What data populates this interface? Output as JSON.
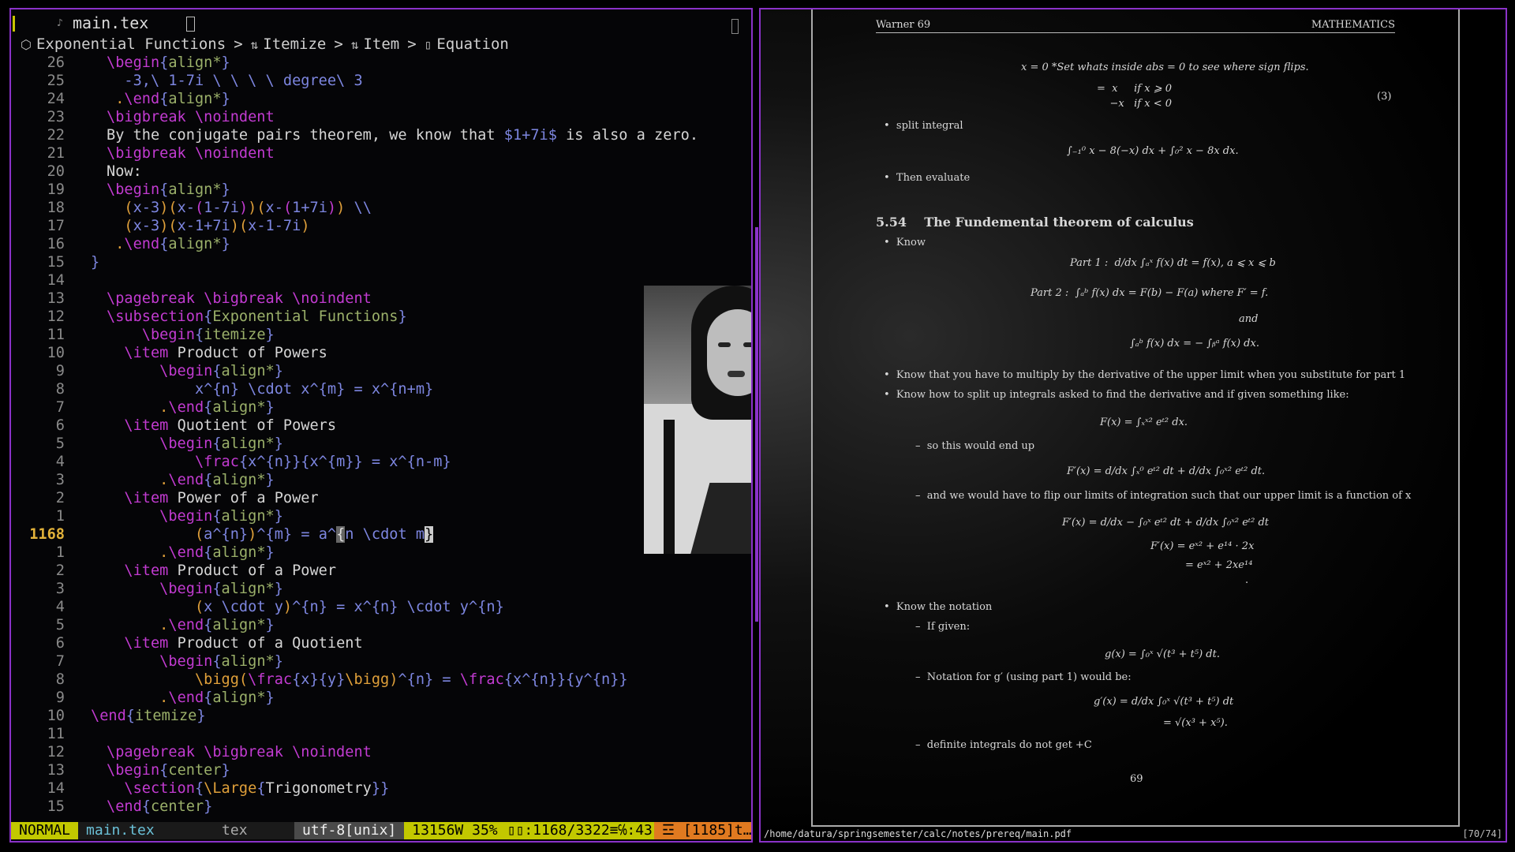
{
  "editor": {
    "tab": {
      "icon": "tex-file-icon",
      "name": "main.tex"
    },
    "winbar": {
      "crumb1": "Exponential Functions",
      "crumb2": "Itemize",
      "crumb3": "Item",
      "crumb4": "Equation"
    },
    "lines": [
      {
        "n": "26",
        "h": "<span class='k'>\\begin</span><span class='b'>{</span><span class='g'>align*</span><span class='b'>}</span>"
      },
      {
        "n": "25",
        "h": "  <span class='c'>-3,\\ 1-7i \\ \\ \\ \\ degree\\ 3</span>"
      },
      {
        "n": "24",
        "h": " <span class='o'>.</span><span class='k'>\\end</span><span class='b'>{</span><span class='g'>align*</span><span class='b'>}</span>"
      },
      {
        "n": "23",
        "h": "<span class='k'>\\bigbreak \\noindent</span>"
      },
      {
        "n": "22",
        "h": "<span class='w'>By the conjugate pairs theorem, we know that </span><span class='c'>$1+7i$</span><span class='w'> is also a zero.</span>"
      },
      {
        "n": "21",
        "h": "<span class='k'>\\bigbreak \\noindent</span>"
      },
      {
        "n": "20",
        "h": "<span class='w'>Now:</span>"
      },
      {
        "n": "19",
        "h": "<span class='k'>\\begin</span><span class='b'>{</span><span class='g'>align*</span><span class='b'>}</span>"
      },
      {
        "n": "18",
        "h": "  <span class='o'>(</span><span class='c'>x-3</span><span class='o'>)(</span><span class='c'>x-</span><span class='k'>(</span><span class='c'>1-7i</span><span class='k'>)</span><span class='o'>)(</span><span class='c'>x-</span><span class='k'>(</span><span class='c'>1+7i</span><span class='k'>)</span><span class='o'>)</span><span class='c'> \\\\</span>"
      },
      {
        "n": "17",
        "h": "  <span class='o'>(</span><span class='c'>x-3</span><span class='o'>)(</span><span class='c'>x-1+7i</span><span class='o'>)(</span><span class='c'>x-1-7i</span><span class='o'>)</span>"
      },
      {
        "n": "16",
        "h": " <span class='o'>.</span><span class='k'>\\end</span><span class='b'>{</span><span class='g'>align*</span><span class='b'>}</span>"
      },
      {
        "n": "15",
        "h": "<span class='b'>}</span>",
        "x": -20
      },
      {
        "n": "14",
        "h": ""
      },
      {
        "n": "13",
        "h": "<span class='k'>\\pagebreak \\bigbreak \\noindent</span>"
      },
      {
        "n": "12",
        "h": "<span class='k'>\\subsection</span><span class='b'>{</span><span class='g'>Exponential Functions</span><span class='b'>}</span>"
      },
      {
        "n": "11",
        "h": "    <span class='k'>\\begin</span><span class='b'>{</span><span class='g'>itemize</span><span class='b'>}</span>"
      },
      {
        "n": "10",
        "h": "  <span class='k'>\\item</span><span class='w'> Product of Powers</span>"
      },
      {
        "n": "9",
        "h": "      <span class='k'>\\begin</span><span class='b'>{</span><span class='g'>align*</span><span class='b'>}</span>"
      },
      {
        "n": "8",
        "h": "          <span class='c'>x^{n} \\cdot x^{m} = x^{n+m}</span>"
      },
      {
        "n": "7",
        "h": "      <span class='o'>.</span><span class='k'>\\end</span><span class='b'>{</span><span class='g'>align*</span><span class='b'>}</span>"
      },
      {
        "n": "6",
        "h": "  <span class='k'>\\item</span><span class='w'> Quotient of Powers</span>"
      },
      {
        "n": "5",
        "h": "      <span class='k'>\\begin</span><span class='b'>{</span><span class='g'>align*</span><span class='b'>}</span>"
      },
      {
        "n": "4",
        "h": "          <span class='k'>\\frac</span><span class='c'>{x^{n}}{x^{m}} = x^{n-m}</span>"
      },
      {
        "n": "3",
        "h": "      <span class='o'>.</span><span class='k'>\\end</span><span class='b'>{</span><span class='g'>align*</span><span class='b'>}</span>"
      },
      {
        "n": "2",
        "h": "  <span class='k'>\\item</span><span class='w'> Power of a Power</span>"
      },
      {
        "n": "1",
        "h": "      <span class='k'>\\begin</span><span class='b'>{</span><span class='g'>align*</span><span class='b'>}</span>"
      },
      {
        "n": "1168",
        "cur": true,
        "h": "          <span class='o'>(</span><span class='c'>a^{n}</span><span class='o'>)</span><span class='c'>^{m} = a^</span><span class='hl'>{</span><span class='c'>n \\cdot m</span><span class='cursor'>}</span>"
      },
      {
        "n": "1",
        "h": "      <span class='o'>.</span><span class='k'>\\end</span><span class='b'>{</span><span class='g'>align*</span><span class='b'>}</span>"
      },
      {
        "n": "2",
        "h": "  <span class='k'>\\item</span><span class='w'> Product of a Power</span>"
      },
      {
        "n": "3",
        "h": "      <span class='k'>\\begin</span><span class='b'>{</span><span class='g'>align*</span><span class='b'>}</span>"
      },
      {
        "n": "4",
        "h": "          <span class='o'>(</span><span class='c'>x \\cdot y</span><span class='o'>)</span><span class='c'>^{n} = x^{n} \\cdot y^{n}</span>"
      },
      {
        "n": "5",
        "h": "      <span class='o'>.</span><span class='k'>\\end</span><span class='b'>{</span><span class='g'>align*</span><span class='b'>}</span>"
      },
      {
        "n": "6",
        "h": "  <span class='k'>\\item</span><span class='w'> Product of a Quotient</span>"
      },
      {
        "n": "7",
        "h": "      <span class='k'>\\begin</span><span class='b'>{</span><span class='g'>align*</span><span class='b'>}</span>"
      },
      {
        "n": "8",
        "h": "          <span class='o'>\\bigg(</span><span class='k'>\\frac</span><span class='c'>{x}{y}</span><span class='o'>\\bigg)</span><span class='c'>^{n} = </span><span class='k'>\\frac</span><span class='c'>{x^{n}}{y^{n}}</span>"
      },
      {
        "n": "9",
        "h": "      <span class='o'>.</span><span class='k'>\\end</span><span class='b'>{</span><span class='g'>align*</span><span class='b'>}</span>"
      },
      {
        "n": "10",
        "h": "<span class='k'>\\end</span><span class='b'>{</span><span class='g'>itemize</span><span class='b'>}</span>",
        "x": -20
      },
      {
        "n": "11",
        "h": ""
      },
      {
        "n": "12",
        "h": "<span class='k'>\\pagebreak \\bigbreak \\noindent</span>"
      },
      {
        "n": "13",
        "h": "<span class='k'>\\begin</span><span class='b'>{</span><span class='g'>center</span><span class='b'>}</span>"
      },
      {
        "n": "14",
        "h": "  <span class='k'>\\section</span><span class='b'>{</span><span class='o'>\\Large</span><span class='b'>{</span><span class='w'>Trigonometry</span><span class='b'>}}</span>"
      },
      {
        "n": "15",
        "h": "<span class='k'>\\end</span><span class='b'>{</span><span class='g'>center</span><span class='b'>}</span>"
      }
    ],
    "status": {
      "mode": "NORMAL",
      "file": "main.tex",
      "filetype": "tex",
      "encoding": "utf-8[unix]",
      "words": "13156W 35%",
      "position": ":1168/3322≡℅:43",
      "diagnostics": "[1185]t…"
    }
  },
  "pdf": {
    "header_left": "Warner 69",
    "header_right": "MATHEMATICS",
    "path": "/home/datura/springsemester/calc/notes/prereq/main.pdf",
    "page_indicator": "[70/74]",
    "page_number": "69",
    "texts": {
      "t1": "x = 0 *Set whats inside abs = 0 to see where sign flips.",
      "t2": "=  x     if x ⩾ 0",
      "t3": "    −x   if x < 0",
      "t4": "(3)",
      "t5": "•  split integral",
      "t6": "∫₋₁⁰ x − 8(−x) dx + ∫₀² x − 8x dx.",
      "t7": "•  Then evaluate",
      "t8": "5.54    The Fundemental theorem of calculus",
      "t9": "•  Know",
      "t10": "Part 1 :  d/dx ∫ₐˣ f(x) dt = f(x), a ⩽ x ⩽ b",
      "t11": "Part 2 :  ∫ₐᵇ f(x) dx = F(b) − F(a) where F′ = f.",
      "t12": "and",
      "t13": "∫ₐᵇ f(x) dx = − ∫ᵦᵃ f(x) dx.",
      "t14": "•  Know that you have to multiply by the derivative of the upper limit when you substitute for part 1",
      "t15": "•  Know how to split up integrals asked to find the derivative and if given something like:",
      "t16": "F(x) = ∫ₓˣ² eᵗ² dx.",
      "t17": "–  so this would end up",
      "t18": "F′(x) = d/dx ∫ₓ⁰ eᵗ² dt + d/dx ∫₀ˣ² eᵗ² dt.",
      "t19": "–  and we would have to flip our limits of integration such that our upper limit is a function of x",
      "t20": "F′(x) = d/dx − ∫₀ˣ eᵗ² dt + d/dx ∫₀ˣ² eᵗ² dt",
      "t21": "F′(x) = eˣ² + e¹⁴ · 2x",
      "t22": "= eˣ² + 2xe¹⁴",
      "t23": ".",
      "t24": "•  Know the notation",
      "t25": "–  If given:",
      "t26": "g(x) = ∫₀ˣ √(t³ + t⁵) dt.",
      "t27": "–  Notation for g′ (using part 1) would be:",
      "t28": "g′(x) = d/dx ∫₀ˣ √(t³ + t⁵) dt",
      "t29": "= √(x³ + x⁵).",
      "t30": "–  definite integrals do not get +C"
    }
  }
}
